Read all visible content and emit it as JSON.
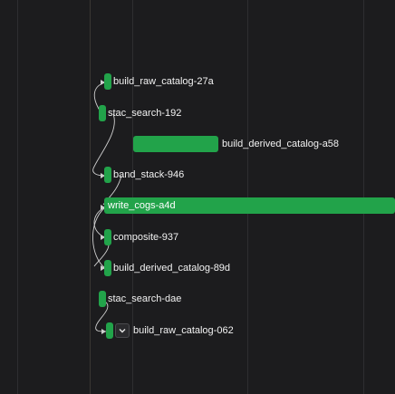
{
  "theme": {
    "background": "#1c1c1e",
    "bar_color": "#22a34a",
    "grid_color": "#2e2e31",
    "link_color": "#cfcfcf"
  },
  "tasks": [
    {
      "label": "build_raw_catalog-27a"
    },
    {
      "label": "stac_search-192"
    },
    {
      "label": "build_derived_catalog-a58"
    },
    {
      "label": "band_stack-946"
    },
    {
      "label": "write_cogs-a4d"
    },
    {
      "label": "composite-937"
    },
    {
      "label": "build_derived_catalog-89d"
    },
    {
      "label": "stac_search-dae"
    },
    {
      "label": "build_raw_catalog-062"
    }
  ],
  "controls": {
    "expand_icon": "chevron-down-icon"
  }
}
